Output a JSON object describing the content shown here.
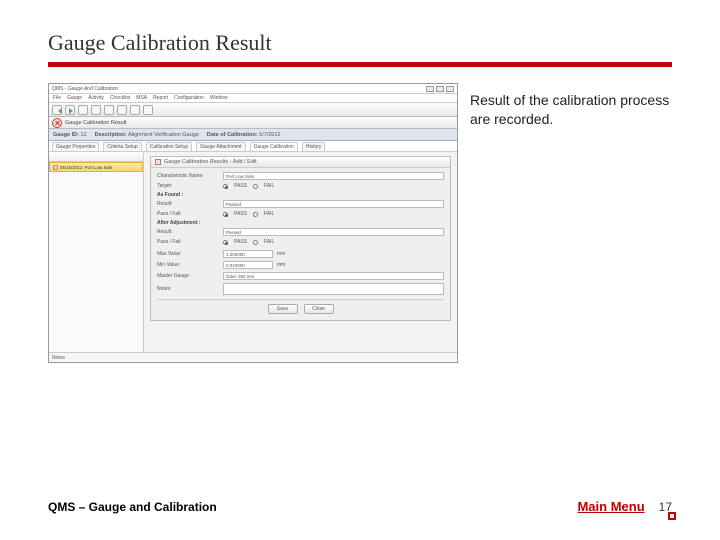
{
  "slide": {
    "title": "Gauge Calibration Result",
    "caption": "Result of the calibration process are recorded."
  },
  "footer": {
    "left": "QMS – Gauge and Calibration",
    "mainmenu": "Main Menu",
    "page": "17"
  },
  "app": {
    "window_title": "QMS - Gauge And Calibration",
    "menus": [
      "File",
      "Gauge",
      "Activity",
      "Checklist",
      "MSA",
      "Report",
      "Configuration",
      "Window"
    ],
    "infobar": {
      "gauge_id_label": "Gauge ID:",
      "gauge_id": "12",
      "desc_label": "Description:",
      "desc": "Alignment Verification Gauge",
      "date_label": "Date of Calibration:",
      "date": "5/7/2012"
    },
    "tabs": [
      "Gauge Properties",
      "Criteria Setup",
      "Calibration Setup",
      "Gauge Attachment",
      "Gauge Calibration",
      "History"
    ],
    "left_row": {
      "date": "05/15/2012",
      "name": "Port Low Side"
    },
    "dialog": {
      "title": "Gauge Calibration Results - Add / Edit",
      "fields": {
        "char_name_label": "Characteristic Name:",
        "char_name": "Port Low Side",
        "target_label": "Target:",
        "asfound_section": "As Found :",
        "result_label": "Result:",
        "result": "Passed",
        "passfail_label": "Pass / Fail:",
        "pass_opt": "PASS",
        "fail_opt": "FAIL",
        "afteradj_section": "After Adjustment :",
        "result2": "Passed",
        "maxvalue_label": "Max Value:",
        "maxvalue": "1.000000",
        "maxvalue_unit": "mm",
        "minvalue_label": "Min Value:",
        "minvalue": "0.010000",
        "minvalue_unit": "mm",
        "master_gauge_label": "Master Gauge:",
        "master_gauge": "Odec 250 mm",
        "notes_label": "Notes:"
      },
      "buttons": {
        "save": "Save",
        "close": "Close"
      }
    },
    "notes_footer": "Notes"
  }
}
